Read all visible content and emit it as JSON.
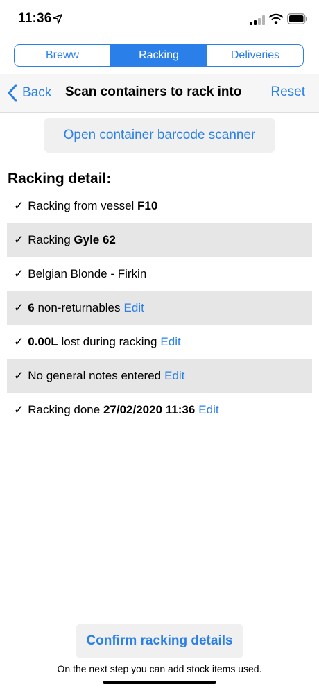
{
  "status_bar": {
    "time": "11:36",
    "icons": [
      "location-arrow-icon",
      "cell-signal-icon",
      "wifi-icon",
      "battery-icon"
    ]
  },
  "tabs": [
    {
      "label": "Breww",
      "active": false
    },
    {
      "label": "Racking",
      "active": true
    },
    {
      "label": "Deliveries",
      "active": false
    }
  ],
  "navbar": {
    "back_label": "Back",
    "title": "Scan containers to rack into",
    "reset_label": "Reset"
  },
  "scanner_button": "Open container barcode scanner",
  "racking_detail": {
    "heading": "Racking detail:",
    "check_mark": "✓",
    "edit_label": "Edit",
    "rows": [
      {
        "prefix": "Racking from vessel ",
        "bold": "F10",
        "suffix": ""
      },
      {
        "prefix": "Racking ",
        "bold": "Gyle 62",
        "suffix": ""
      },
      {
        "text": "Belgian Blonde - Firkin"
      },
      {
        "bold": "6",
        "suffix": " non-returnables"
      },
      {
        "bold": "0.00L",
        "suffix": " lost during racking"
      },
      {
        "text": "No general notes entered"
      },
      {
        "prefix": "Racking done ",
        "bold": "27/02/2020 11:36"
      }
    ]
  },
  "confirm_button": "Confirm racking details",
  "footer_note": "On the next step you can add stock items used.",
  "colors": {
    "accent": "#2a7fe8",
    "row_shade": "#e6e6e6",
    "button_bg": "#f0f0f0"
  }
}
